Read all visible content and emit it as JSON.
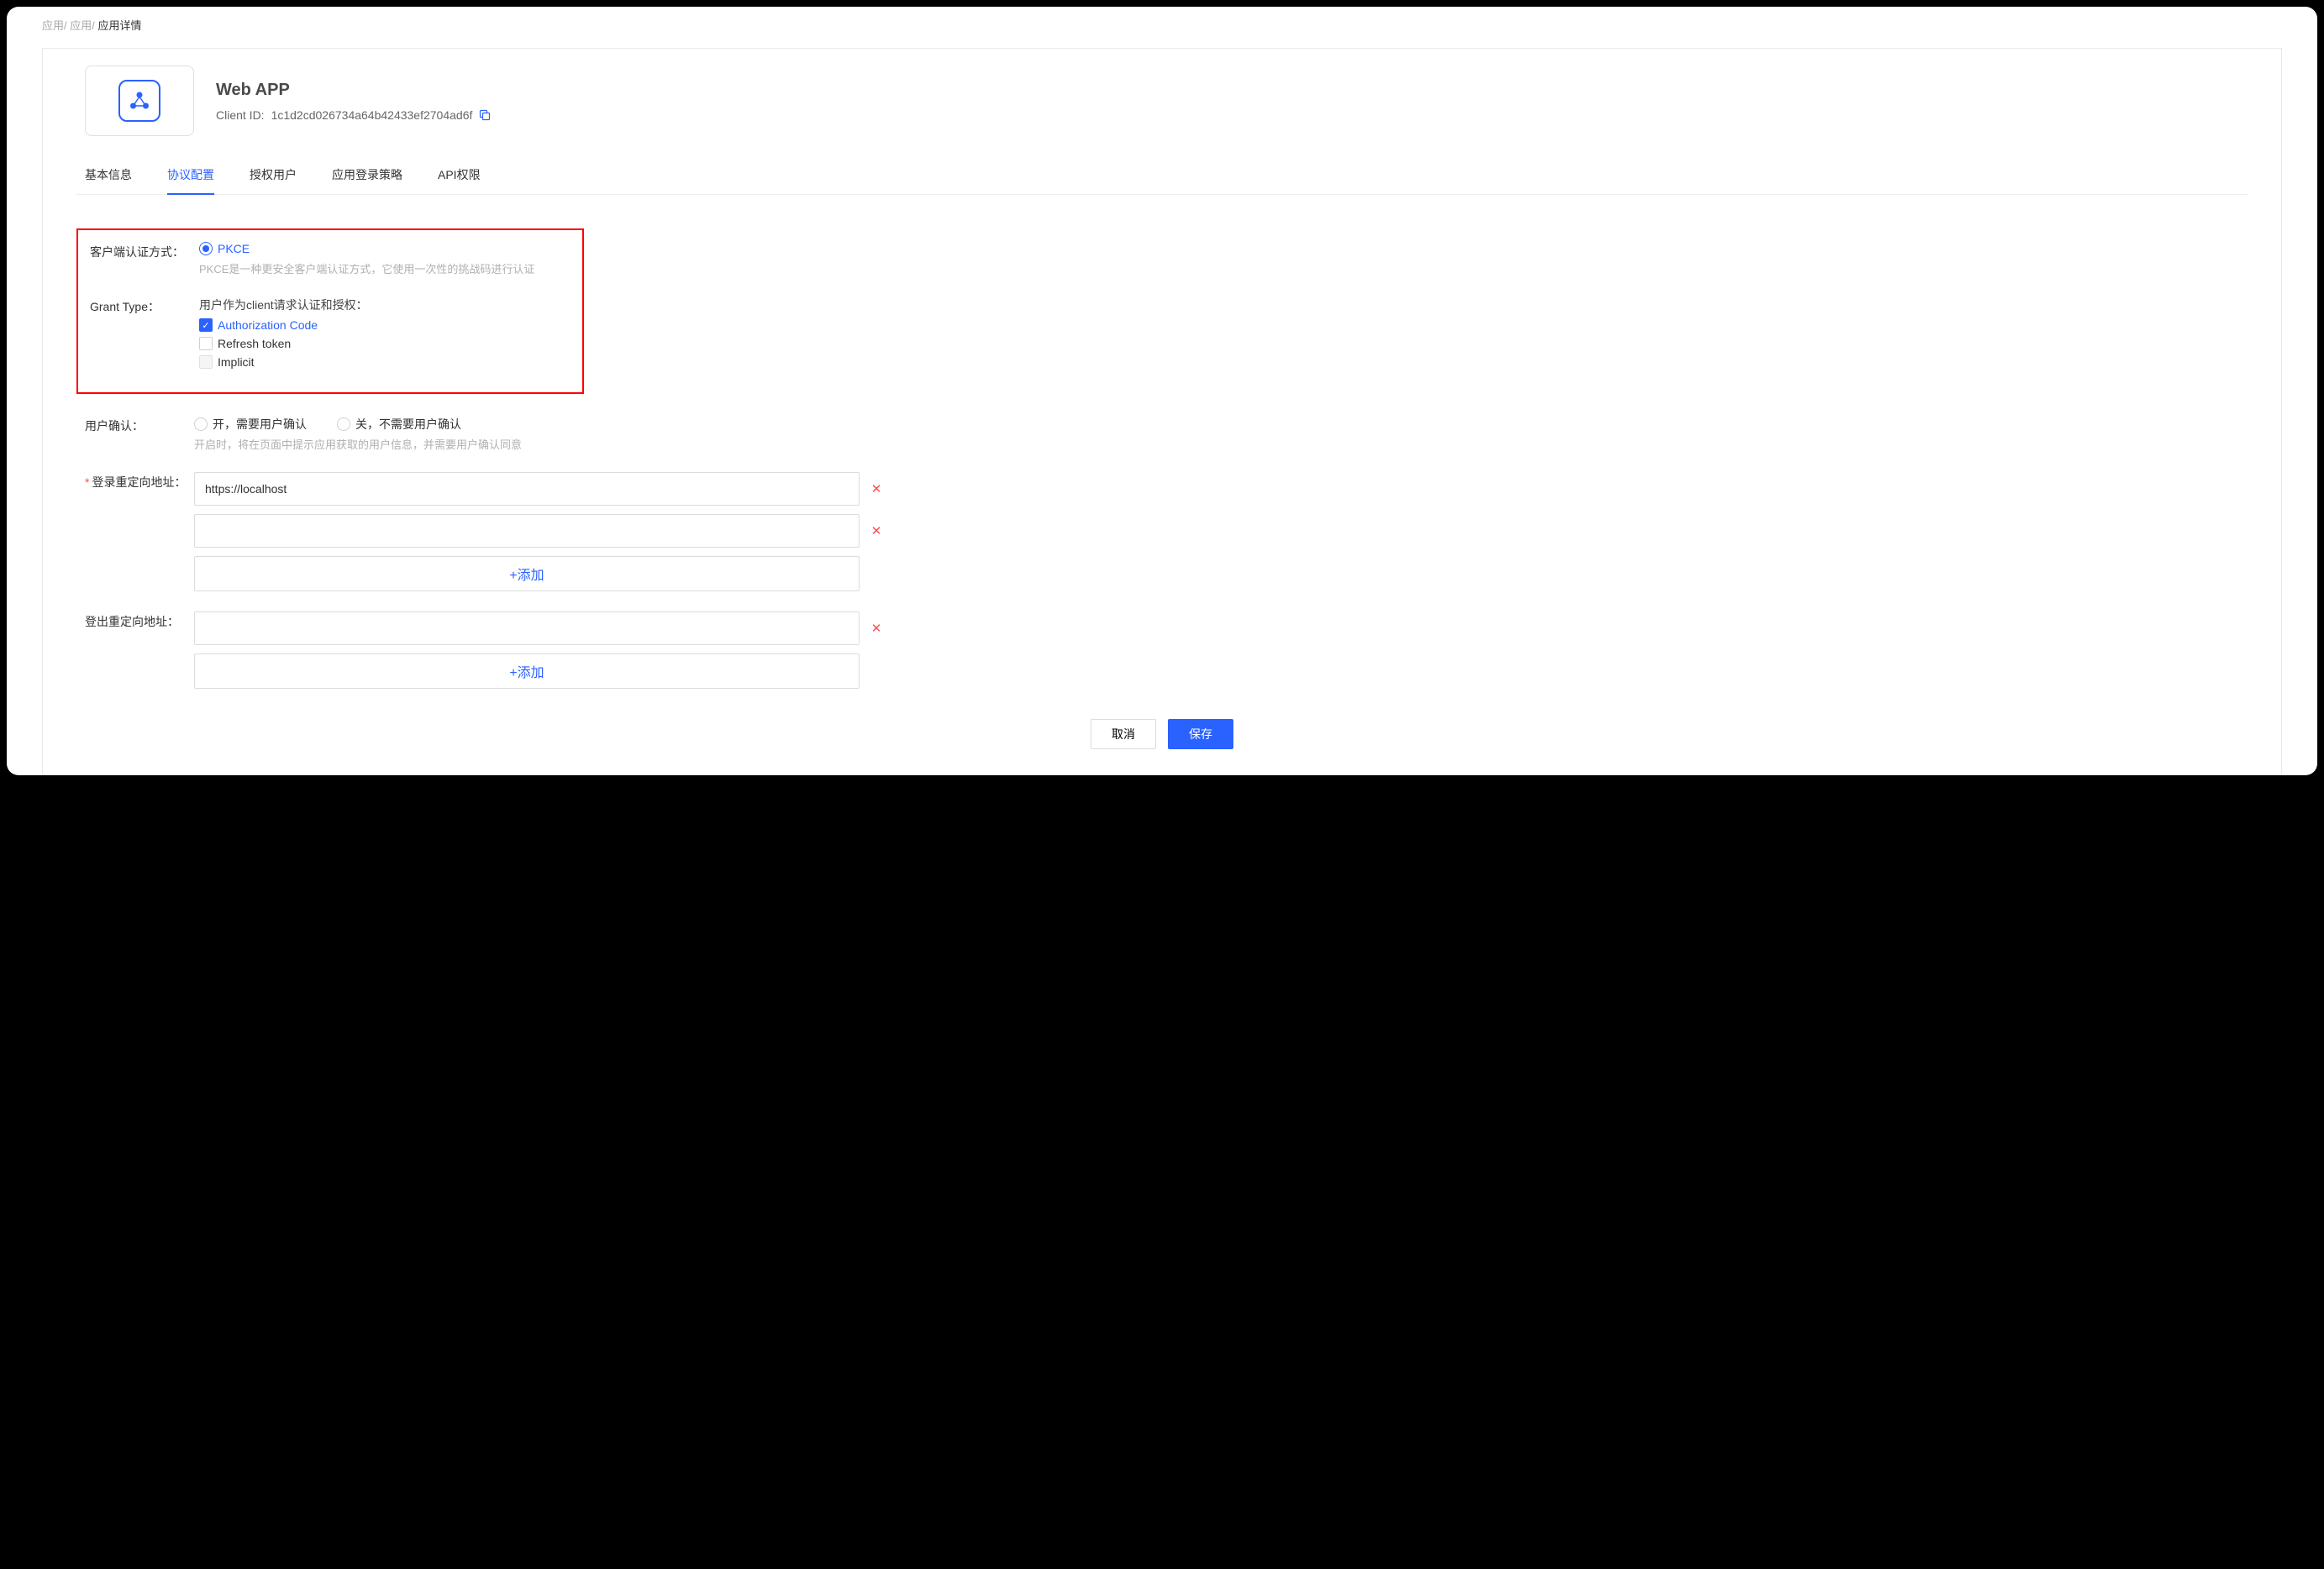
{
  "breadcrumb": {
    "a": "应用",
    "b": "应用",
    "c": "应用详情"
  },
  "app": {
    "title": "Web APP",
    "client_id_label": "Client ID:",
    "client_id": "1c1d2cd026734a64b42433ef2704ad6f"
  },
  "tabs": {
    "basic": "基本信息",
    "protocol": "协议配置",
    "authz": "授权用户",
    "login": "应用登录策略",
    "api": "API权限"
  },
  "form": {
    "client_auth_label": "客户端认证方式：",
    "pkce": "PKCE",
    "pkce_hint": "PKCE是一种更安全客户端认证方式，它使用一次性的挑战码进行认证",
    "grant_type_label": "Grant Type：",
    "grant_heading": "用户作为client请求认证和授权：",
    "authorization_code": "Authorization Code",
    "refresh_token": "Refresh token",
    "implicit": "Implicit",
    "user_confirm_label": "用户确认：",
    "confirm_on": "开，需要用户确认",
    "confirm_off": "关，不需要用户确认",
    "confirm_hint": "开启时，将在页面中提示应用获取的用户信息，并需要用户确认同意",
    "login_redirect_label": "登录重定向地址：",
    "login_redirect_value1": "https://localhost",
    "add_btn": "+添加",
    "logout_redirect_label": "登出重定向地址：",
    "cancel": "取消",
    "save": "保存",
    "required_mark": "*"
  }
}
